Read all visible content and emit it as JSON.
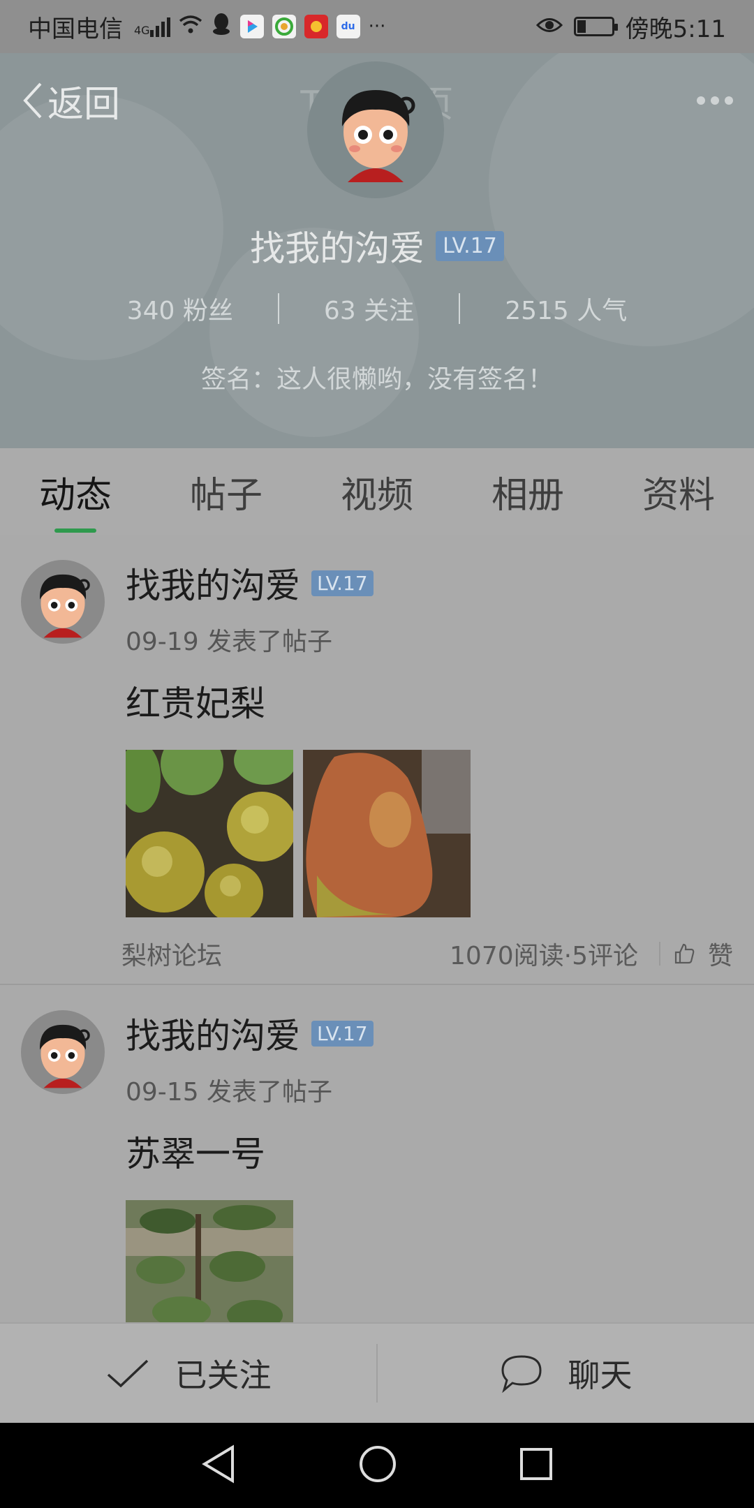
{
  "status_bar": {
    "carrier": "中国电信",
    "network": "4G",
    "time": "傍晚5:11",
    "more": "···"
  },
  "header": {
    "back_label": "返回",
    "title": "TA的主页",
    "username": "找我的沟爱",
    "level": "LV.17",
    "followers": "340 粉丝",
    "following": "63 关注",
    "popularity": "2515 人气",
    "signature": "签名：这人很懒哟，没有签名！"
  },
  "tabs": [
    {
      "label": "动态",
      "active": true
    },
    {
      "label": "帖子",
      "active": false
    },
    {
      "label": "视频",
      "active": false
    },
    {
      "label": "相册",
      "active": false
    },
    {
      "label": "资料",
      "active": false
    }
  ],
  "posts": [
    {
      "author": "找我的沟爱",
      "level": "LV.17",
      "meta": "09-19 发表了帖子",
      "title": "红贵妃梨",
      "forum": "梨树论坛",
      "stats": "1070阅读·5评论",
      "like_label": "赞"
    },
    {
      "author": "找我的沟爱",
      "level": "LV.17",
      "meta": "09-15 发表了帖子",
      "title": "苏翠一号"
    }
  ],
  "actions": {
    "follow_label": "已关注",
    "chat_label": "聊天"
  },
  "colors": {
    "accent": "#2e9a4d",
    "level_badge": "#6a8fb8"
  }
}
